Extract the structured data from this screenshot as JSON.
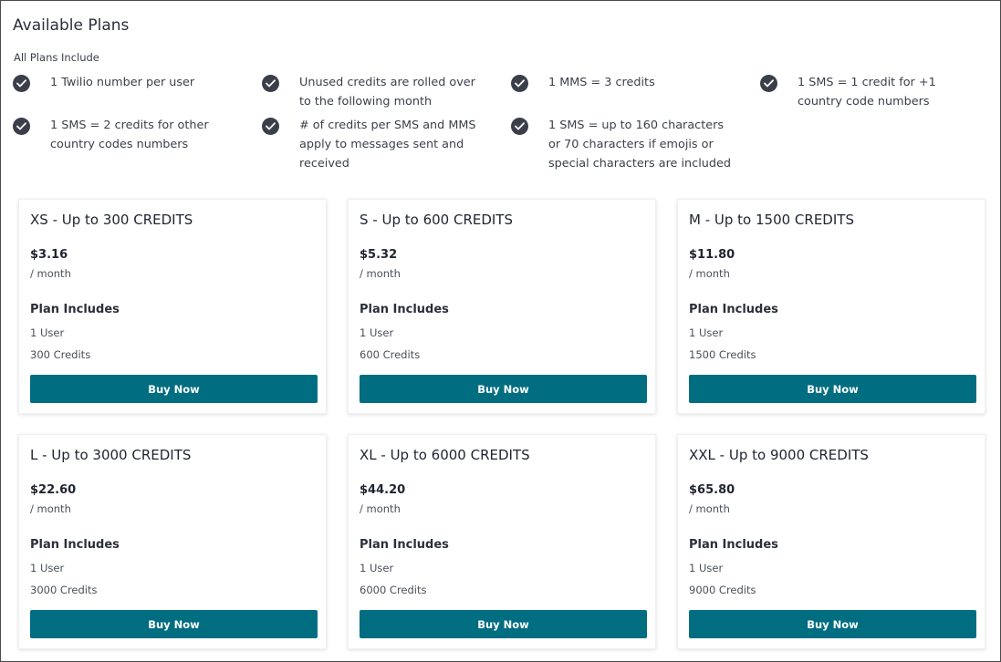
{
  "page": {
    "title": "Available Plans",
    "includes_label": "All Plans Include"
  },
  "features": [
    {
      "text": "1 Twilio number per user",
      "icon": "check-circle-icon"
    },
    {
      "text": "Unused credits are rolled over to the following month",
      "icon": "check-circle-icon"
    },
    {
      "text": "1 MMS = 3 credits",
      "icon": "check-circle-icon"
    },
    {
      "text": "1 SMS = 1 credit for +1 country code numbers",
      "icon": "check-circle-icon"
    },
    {
      "text": "1 SMS = 2 credits for other country codes numbers",
      "icon": "check-circle-icon"
    },
    {
      "text": "# of credits per SMS and MMS apply to messages sent and received",
      "icon": "check-circle-icon"
    },
    {
      "text": "1 SMS = up to 160 characters or 70 characters if emojis or special characters are included",
      "icon": "check-circle-icon"
    }
  ],
  "plans": [
    {
      "title": "XS - Up to 300 CREDITS",
      "price": "$3.16",
      "period": "/ month",
      "includes_label": "Plan Includes",
      "users": "1 User",
      "credits": "300 Credits",
      "button": "Buy Now"
    },
    {
      "title": "S - Up to 600 CREDITS",
      "price": "$5.32",
      "period": "/ month",
      "includes_label": "Plan Includes",
      "users": "1 User",
      "credits": "600 Credits",
      "button": "Buy Now"
    },
    {
      "title": "M - Up to 1500 CREDITS",
      "price": "$11.80",
      "period": "/ month",
      "includes_label": "Plan Includes",
      "users": "1 User",
      "credits": "1500 Credits",
      "button": "Buy Now"
    },
    {
      "title": "L - Up to 3000 CREDITS",
      "price": "$22.60",
      "period": "/ month",
      "includes_label": "Plan Includes",
      "users": "1 User",
      "credits": "3000 Credits",
      "button": "Buy Now"
    },
    {
      "title": "XL - Up to 6000 CREDITS",
      "price": "$44.20",
      "period": "/ month",
      "includes_label": "Plan Includes",
      "users": "1 User",
      "credits": "6000 Credits",
      "button": "Buy Now"
    },
    {
      "title": "XXL - Up to 9000 CREDITS",
      "price": "$65.80",
      "period": "/ month",
      "includes_label": "Plan Includes",
      "users": "1 User",
      "credits": "9000 Credits",
      "button": "Buy Now"
    }
  ],
  "colors": {
    "button_bg": "#006d81",
    "check_bg": "#3a3f4a",
    "text_dark": "#1f2430"
  }
}
